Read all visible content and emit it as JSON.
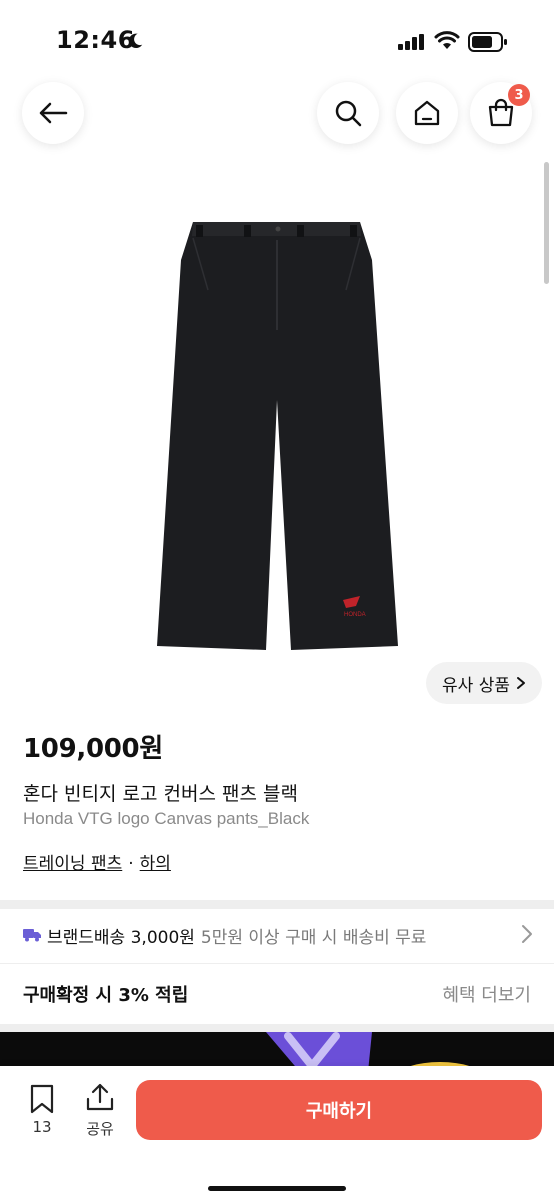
{
  "status_bar": {
    "time": "12:46"
  },
  "header": {
    "cart_count": "3"
  },
  "product": {
    "similar_label": "유사 상품",
    "price": "109,000원",
    "title_ko": "혼다 빈티지 로고 컨버스 팬츠 블랙",
    "title_en": "Honda VTG logo Canvas pants_Black",
    "category": "트레이닝 팬츠",
    "separator": "·",
    "subcategory": "하의",
    "image_text": "HONDA"
  },
  "shipping": {
    "fee_text": "브랜드배송 3,000원",
    "note": "5만원 이상 구매 시 배송비 무료"
  },
  "benefit": {
    "label": "구매확정 시 3% 적립",
    "more": "혜택 더보기"
  },
  "bottom_bar": {
    "bookmark_count": "13",
    "share_label": "공유",
    "buy_label": "구매하기"
  },
  "colors": {
    "accent": "#ef5b4b",
    "shipping_icon": "#6b5fd6"
  }
}
